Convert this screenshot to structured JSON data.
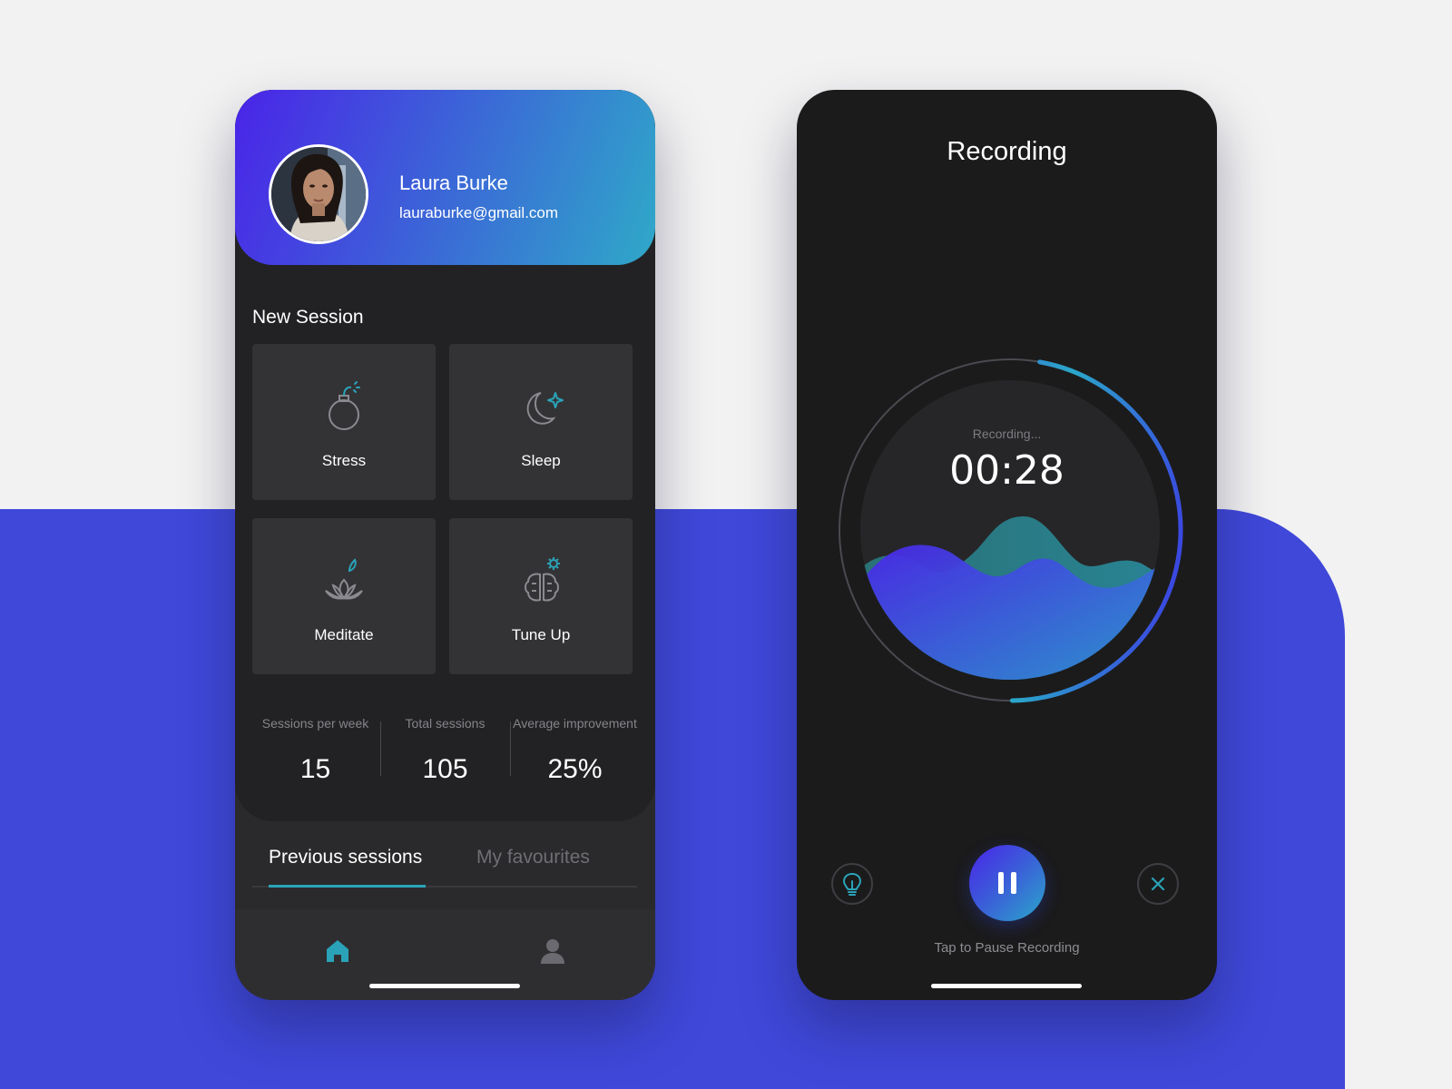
{
  "profile": {
    "name": "Laura Burke",
    "email": "lauraburke@gmail.com"
  },
  "new_session": {
    "title": "New Session",
    "tiles": [
      {
        "label": "Stress",
        "icon": "bomb-icon"
      },
      {
        "label": "Sleep",
        "icon": "moon-star-icon"
      },
      {
        "label": "Meditate",
        "icon": "lotus-icon"
      },
      {
        "label": "Tune Up",
        "icon": "brain-gear-icon"
      }
    ]
  },
  "stats": [
    {
      "label": "Sessions per week",
      "value": "15"
    },
    {
      "label": "Total sessions",
      "value": "105"
    },
    {
      "label": "Average improvement",
      "value": "25%"
    }
  ],
  "tabs": [
    {
      "label": "Previous sessions",
      "active": true
    },
    {
      "label": "My favourites",
      "active": false
    }
  ],
  "bottom_nav": [
    {
      "icon": "home-icon",
      "active": true
    },
    {
      "icon": "user-icon",
      "active": false
    }
  ],
  "recording": {
    "title": "Recording",
    "status": "Recording...",
    "time": "00:28",
    "progress_fraction": 0.47,
    "hint": "Tap to Pause Recording"
  },
  "colors": {
    "accent_teal": "#2aa3b8",
    "accent_indigo": "#4a24e8",
    "background_blue": "#3f48d9",
    "dark_surface": "#222224"
  }
}
